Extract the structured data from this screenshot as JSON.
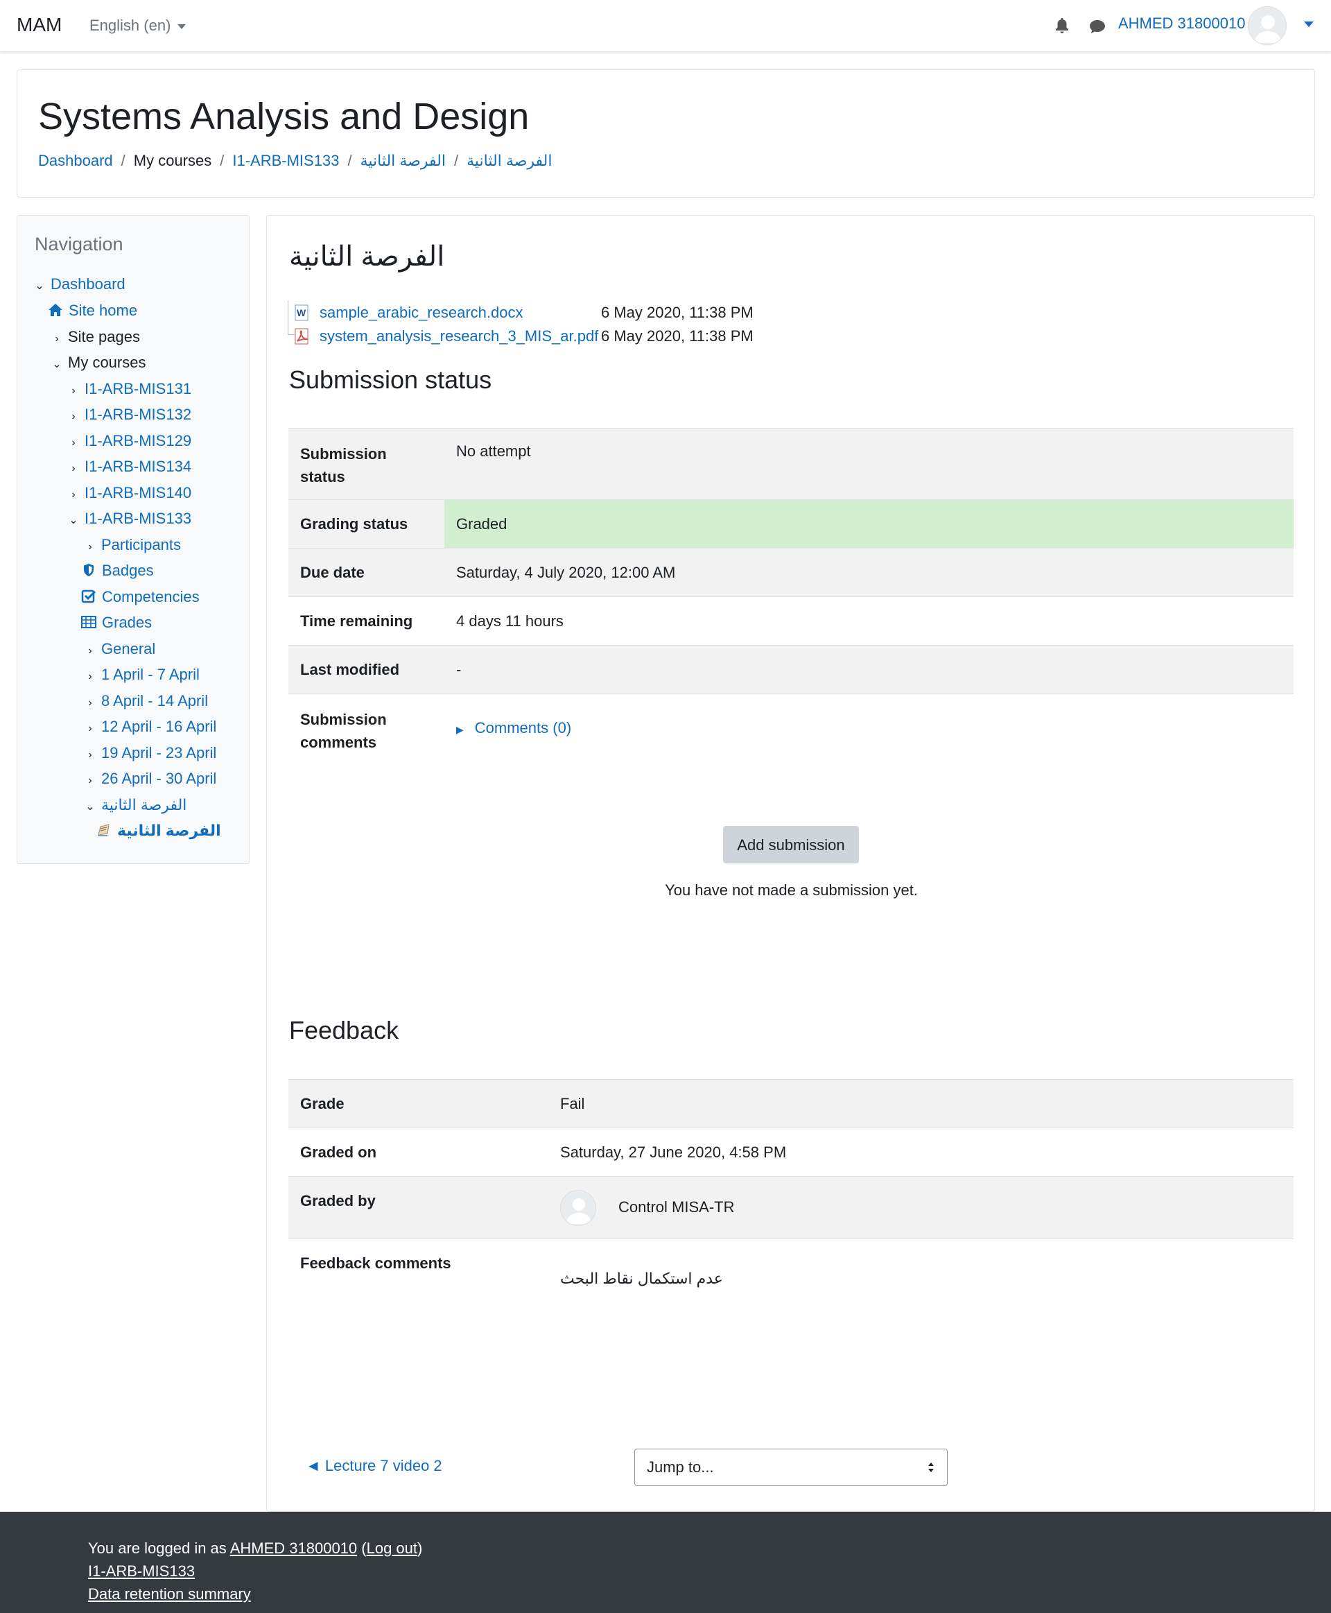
{
  "navbar": {
    "brand": "MAM",
    "language": "English (en)",
    "user_name": "AHMED 31800010"
  },
  "header": {
    "title": "Systems Analysis and Design",
    "breadcrumb": [
      "Dashboard",
      "My courses",
      "I1-ARB-MIS133",
      "الفرصة الثانية",
      "الفرصة الثانية"
    ]
  },
  "navigation": {
    "title": "Navigation",
    "items": [
      {
        "label": "Dashboard",
        "icon": "chevron-down-icon"
      },
      {
        "label": "Site home",
        "icon": "home-icon"
      },
      {
        "label": "Site pages",
        "icon": "chevron-right-icon"
      },
      {
        "label": "My courses",
        "icon": "chevron-down-icon"
      },
      {
        "label": "I1-ARB-MIS131",
        "icon": "chevron-right-icon"
      },
      {
        "label": "I1-ARB-MIS132",
        "icon": "chevron-right-icon"
      },
      {
        "label": "I1-ARB-MIS129",
        "icon": "chevron-right-icon"
      },
      {
        "label": "I1-ARB-MIS134",
        "icon": "chevron-right-icon"
      },
      {
        "label": "I1-ARB-MIS140",
        "icon": "chevron-right-icon"
      },
      {
        "label": "I1-ARB-MIS133",
        "icon": "chevron-down-icon"
      },
      {
        "label": "Participants",
        "icon": "chevron-right-icon"
      },
      {
        "label": "Badges",
        "icon": "shield-icon"
      },
      {
        "label": "Competencies",
        "icon": "checkbox-icon"
      },
      {
        "label": "Grades",
        "icon": "table-icon"
      },
      {
        "label": "General",
        "icon": "chevron-right-icon"
      },
      {
        "label": "1 April - 7 April",
        "icon": "chevron-right-icon"
      },
      {
        "label": "8 April - 14 April",
        "icon": "chevron-right-icon"
      },
      {
        "label": "12 April - 16 April",
        "icon": "chevron-right-icon"
      },
      {
        "label": "19 April - 23 April",
        "icon": "chevron-right-icon"
      },
      {
        "label": "26 April - 30 April",
        "icon": "chevron-right-icon"
      },
      {
        "label": "الفرصة الثانية",
        "icon": "chevron-down-icon"
      },
      {
        "label": "الفرصة الثانية",
        "icon": "assignment-icon"
      }
    ]
  },
  "activity": {
    "title": "الفرصة الثانية",
    "files": [
      {
        "name": "sample_arabic_research.docx",
        "date": "6 May 2020, 11:38 PM",
        "icon": "word-file-icon"
      },
      {
        "name": "system_analysis_research_3_MIS_ar.pdf",
        "date": "6 May 2020, 11:38 PM",
        "icon": "pdf-file-icon"
      }
    ]
  },
  "submission": {
    "heading": "Submission status",
    "rows": {
      "status_label": "Submission status",
      "status_value": "No attempt",
      "grading_label": "Grading status",
      "grading_value": "Graded",
      "due_label": "Due date",
      "due_value": "Saturday, 4 July 2020, 12:00 AM",
      "remaining_label": "Time remaining",
      "remaining_value": "4 days 11 hours",
      "modified_label": "Last modified",
      "modified_value": "-",
      "comments_label": "Submission comments",
      "comments_value": "Comments (0)"
    },
    "add_button": "Add submission",
    "note": "You have not made a submission yet.",
    "graded_color": "#d1eecf"
  },
  "feedback": {
    "heading": "Feedback",
    "grade_label": "Grade",
    "grade_value": "Fail",
    "graded_on_label": "Graded on",
    "graded_on_value": "Saturday, 27 June 2020, 4:58 PM",
    "graded_by_label": "Graded by",
    "graded_by_value": "Control MISA-TR",
    "comments_label": "Feedback comments",
    "comments_value": "عدم استكمال نقاط البحث"
  },
  "activity_nav": {
    "prev_link": "◄ Lecture 7 video 2",
    "jump_placeholder": "Jump to..."
  },
  "footer": {
    "logged_in_prefix": "You are logged in as ",
    "user_link": "AHMED 31800010",
    "open_paren": " (",
    "logout_link": "Log out",
    "close_paren": ")",
    "course_link": "I1-ARB-MIS133",
    "retention_link": "Data retention summary"
  },
  "colors": {
    "link": "#0f6cbf",
    "footer_bg": "#343a40",
    "table_shade": "#f2f2f2"
  }
}
